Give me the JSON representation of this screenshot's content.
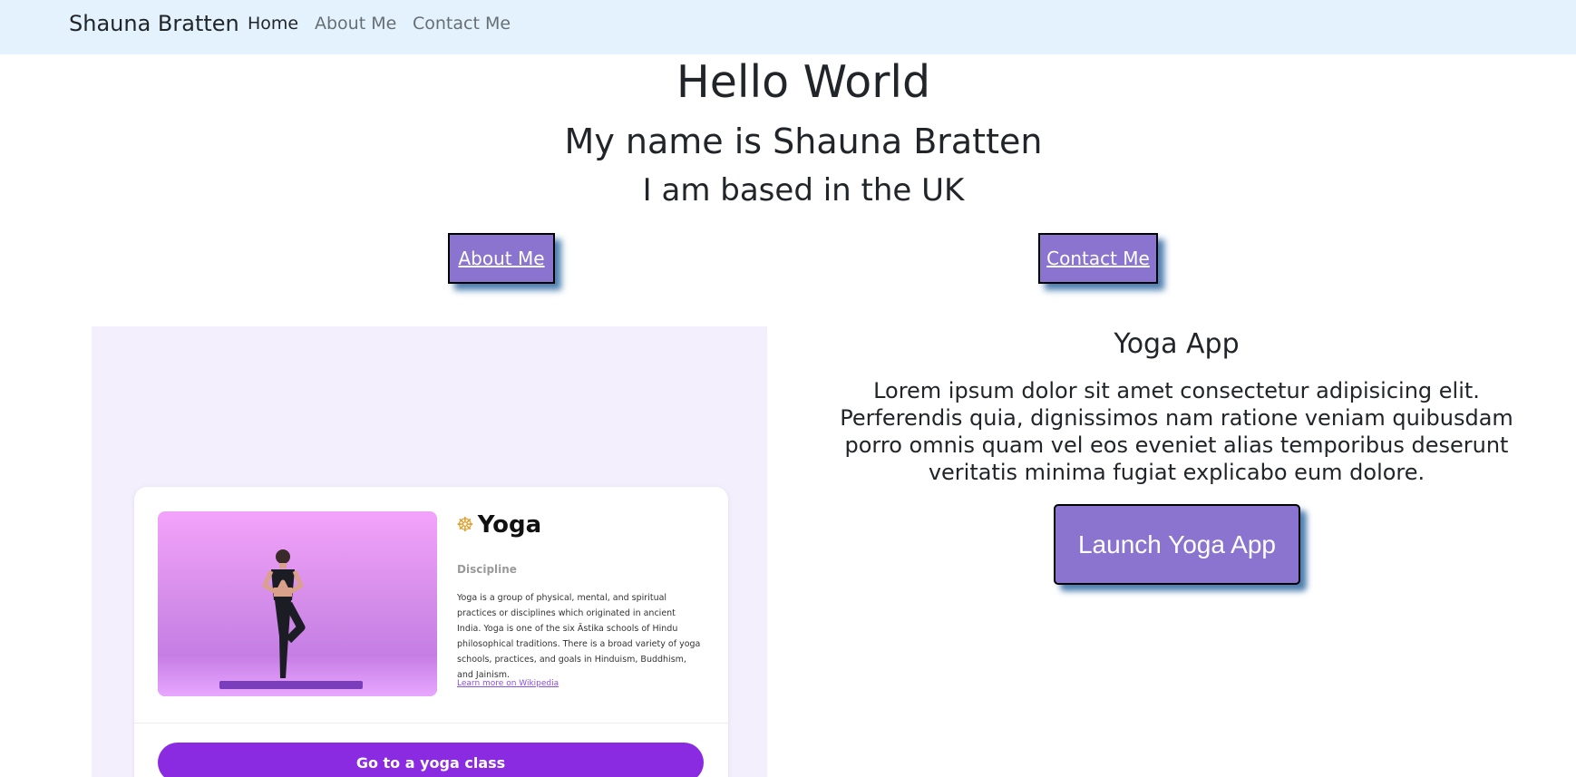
{
  "navbar": {
    "brand": "Shauna Bratten",
    "links": [
      {
        "label": "Home",
        "active": true
      },
      {
        "label": "About Me",
        "active": false
      },
      {
        "label": "Contact Me",
        "active": false
      }
    ]
  },
  "hero": {
    "heading": "Hello World",
    "subheading": "My name is Shauna Bratten",
    "location": "I am based in the UK"
  },
  "buttons": {
    "about": "About Me",
    "contact": "Contact Me"
  },
  "preview_card": {
    "title": "Yoga",
    "icon": "person-in-lotus-position-icon",
    "subtitle": "Discipline",
    "description": "Yoga is a group of physical, mental, and spiritual practices or disciplines which originated in ancient India. Yoga is one of the six Āstika schools of Hindu philosophical traditions. There is a broad variety of yoga schools, practices, and goals in Hinduism, Buddhism, and Jainism.",
    "link": "Learn more on Wikipedia",
    "cta": "Go to a yoga class"
  },
  "project": {
    "title": "Yoga App",
    "description": "Lorem ipsum dolor sit amet consectetur adipisicing elit. Perferendis quia, dignissimos nam ratione veniam quibusdam porro omnis quam vel eos eveniet alias temporibus deserunt veritatis minima fugiat explicabo eum dolore.",
    "launch_label": "Launch Yoga App"
  },
  "colors": {
    "navbar_bg": "#e3f2fd",
    "button_purple": "#8a74cf",
    "button_shadow": "#4d7fb0",
    "card_cta": "#8a2be2"
  }
}
